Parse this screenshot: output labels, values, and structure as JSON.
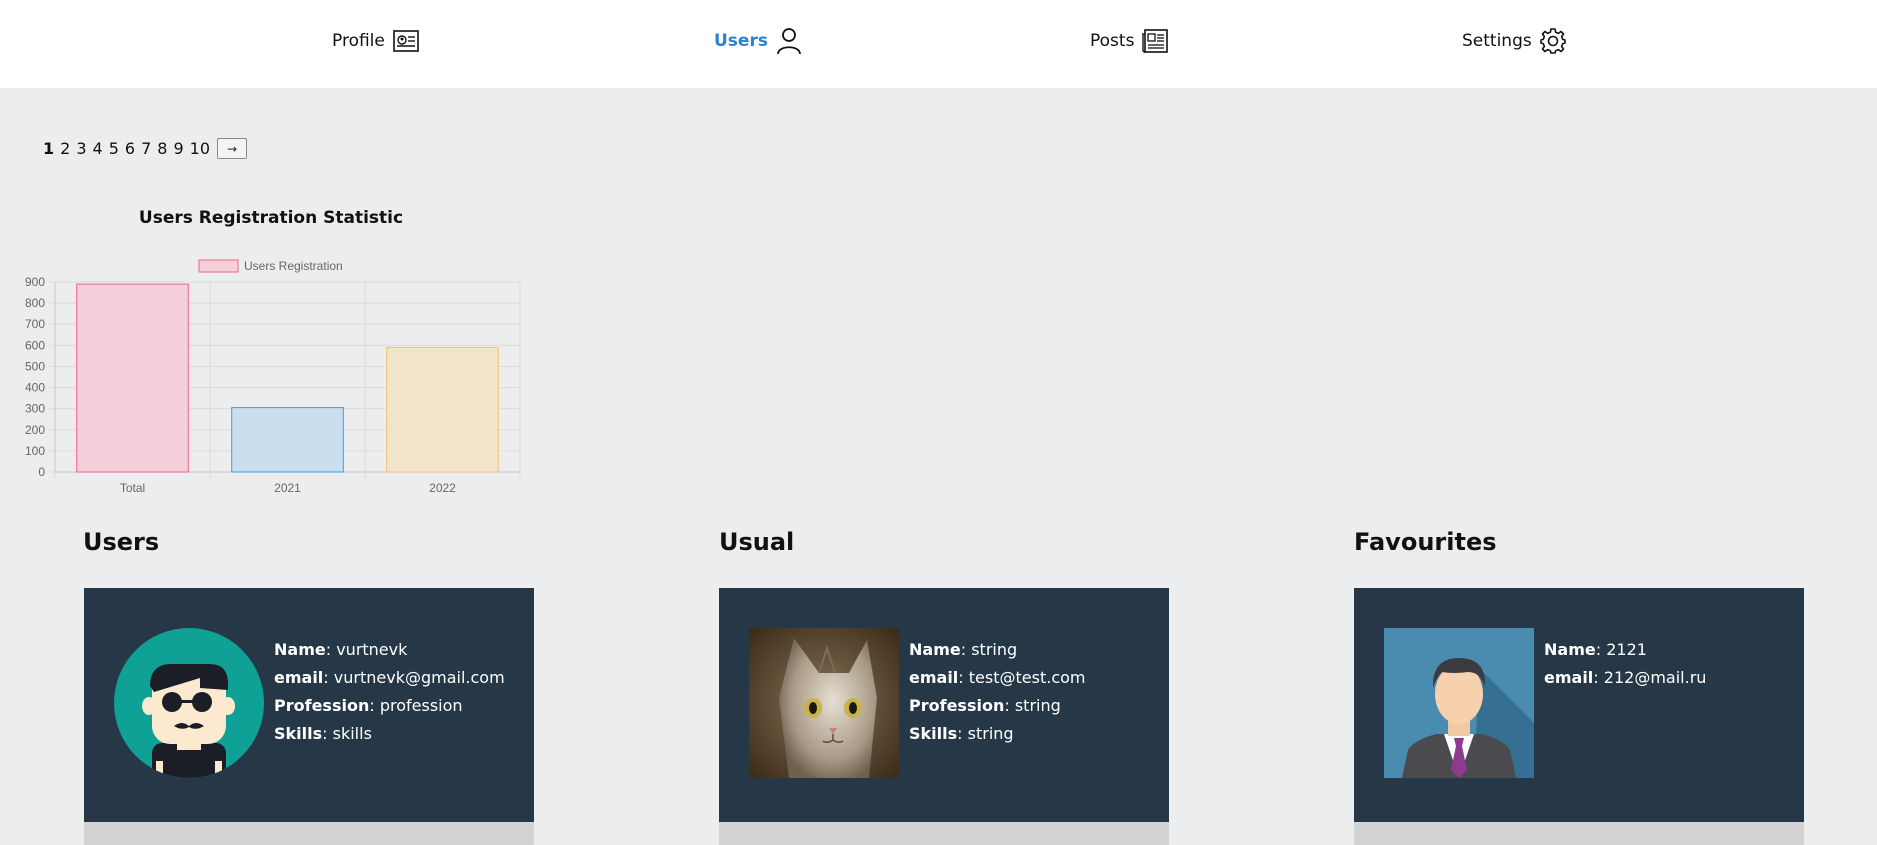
{
  "nav": {
    "items": [
      {
        "label": "Profile",
        "icon": "profile-card-icon"
      },
      {
        "label": "Users",
        "icon": "user-icon",
        "active": true
      },
      {
        "label": "Posts",
        "icon": "newspaper-icon"
      },
      {
        "label": "Settings",
        "icon": "gear-icon"
      }
    ],
    "active_color": "#2c82d6"
  },
  "pagination": {
    "pages": [
      "1",
      "2",
      "3",
      "4",
      "5",
      "6",
      "7",
      "8",
      "9",
      "10"
    ],
    "current": "1",
    "next_label": "→"
  },
  "chart_data": {
    "type": "bar",
    "title": "Users Registration Statistic",
    "categories": [
      "Total",
      "2021",
      "2022"
    ],
    "series": [
      {
        "name": "Users Registration",
        "values": [
          890,
          305,
          590
        ]
      }
    ],
    "bar_fill_colors": [
      "#f3d0da",
      "#c9deee",
      "#f1e4cb"
    ],
    "bar_border_colors": [
      "#f06386",
      "#3f9ae0",
      "#f2c270"
    ],
    "yticks": [
      "0",
      "100",
      "200",
      "300",
      "400",
      "500",
      "600",
      "700",
      "800",
      "900"
    ],
    "ylim": [
      0,
      900
    ],
    "grid": true,
    "legend": "top"
  },
  "sections": {
    "users": {
      "title": "Users",
      "avatar": "cartoon-man-avatar",
      "fields": [
        {
          "label": "Name",
          "value": "vurtnevk"
        },
        {
          "label": "email",
          "value": "vurtnevk@gmail.com"
        },
        {
          "label": "Profession",
          "value": "profession"
        },
        {
          "label": "Skills",
          "value": "skills"
        }
      ]
    },
    "usual": {
      "title": "Usual",
      "avatar": "cat-photo",
      "fields": [
        {
          "label": "Name",
          "value": "string"
        },
        {
          "label": "email",
          "value": "test@test.com"
        },
        {
          "label": "Profession",
          "value": "string"
        },
        {
          "label": "Skills",
          "value": "string"
        }
      ]
    },
    "favourites": {
      "title": "Favourites",
      "avatar": "businessman-avatar",
      "fields": [
        {
          "label": "Name",
          "value": "2121"
        },
        {
          "label": "email",
          "value": "212@mail.ru"
        }
      ]
    }
  },
  "colors": {
    "card_background": "#263847",
    "page_background": "#ecedef"
  }
}
